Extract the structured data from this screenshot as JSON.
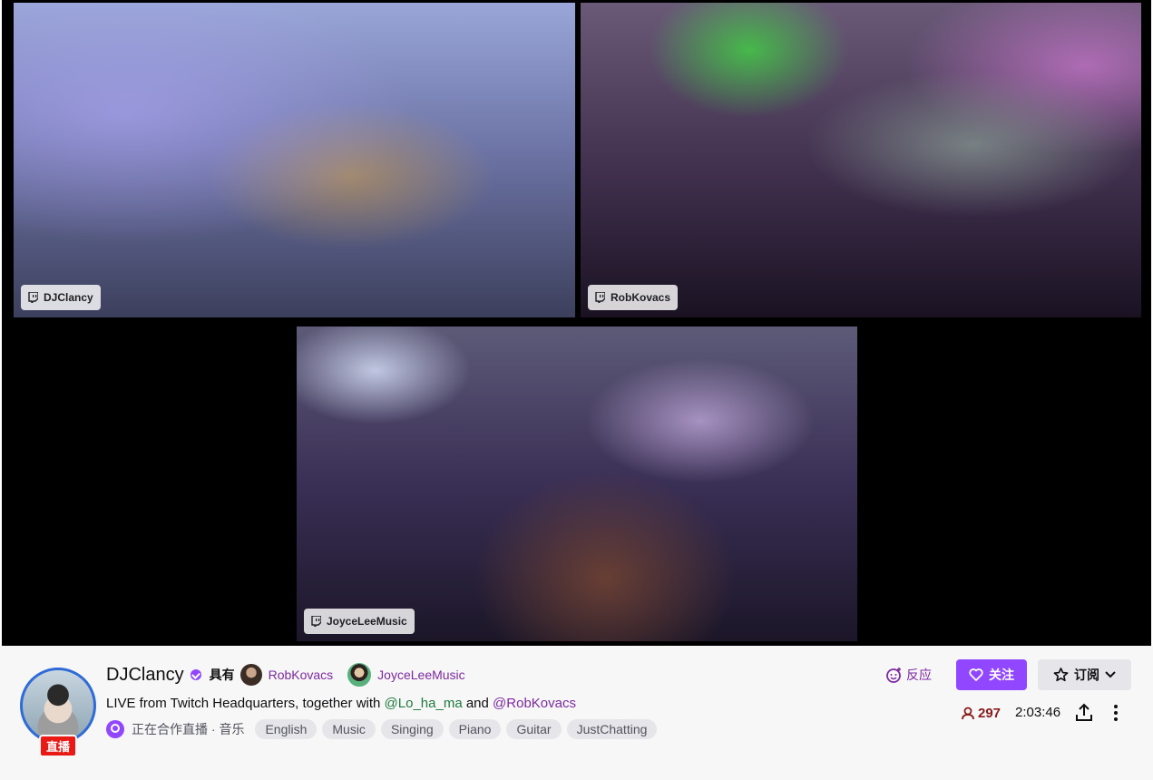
{
  "player": {
    "cams": [
      {
        "label": "DJClancy"
      },
      {
        "label": "RobKovacs"
      },
      {
        "label": "JoyceLeeMusic"
      }
    ]
  },
  "channel": {
    "name": "DJClancy",
    "live_badge": "直播",
    "with_label": "具有",
    "collaborators": [
      {
        "name": "RobKovacs"
      },
      {
        "name": "JoyceLeeMusic"
      }
    ]
  },
  "stream": {
    "title_prefix": "LIVE from Twitch Headquarters, together with ",
    "mention_1": "@Lo_ha_ma",
    "title_mid": " and ",
    "mention_2": "@RobKovacs",
    "collab_status": "正在合作直播",
    "separator": " · ",
    "category": "音乐",
    "tags": [
      "English",
      "Music",
      "Singing",
      "Piano",
      "Guitar",
      "JustChatting"
    ]
  },
  "actions": {
    "react_label": "反应",
    "follow_label": "关注",
    "subscribe_label": "订阅",
    "viewer_count": "297",
    "uptime": "2:03:46"
  },
  "colors": {
    "accent": "#9147ff",
    "link_purple": "#7d29a3",
    "live_red": "#e91916",
    "viewer_red": "#8b1a1a"
  },
  "icons": [
    "twitch-icon",
    "verified-icon",
    "collab-live-icon",
    "reaction-icon",
    "heart-icon",
    "star-icon",
    "chevron-down-icon",
    "viewer-person-icon",
    "share-icon",
    "more-vertical-icon"
  ]
}
